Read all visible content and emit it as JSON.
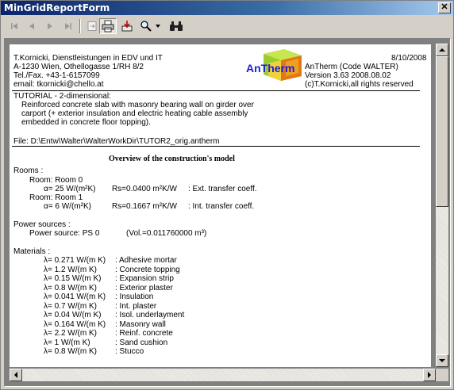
{
  "window": {
    "title": "MinGridReportForm",
    "close_glyph": "✕"
  },
  "toolbar": {
    "buttons": [
      {
        "name": "first-page-button",
        "icon": "first-page-icon"
      },
      {
        "name": "prev-page-button",
        "icon": "prev-page-icon"
      },
      {
        "name": "next-page-button",
        "icon": "next-page-icon"
      },
      {
        "name": "last-page-button",
        "icon": "last-page-icon"
      },
      {
        "name": "goto-page-button",
        "icon": "goto-page-icon"
      },
      {
        "name": "print-button",
        "icon": "printer-icon"
      },
      {
        "name": "export-button",
        "icon": "export-icon"
      },
      {
        "name": "zoom-button",
        "icon": "magnifier-icon"
      },
      {
        "name": "zoom-dropdown-button",
        "icon": "dropdown-arrow-icon"
      },
      {
        "name": "find-button",
        "icon": "binoculars-icon"
      }
    ]
  },
  "report": {
    "header": {
      "company_lines": [
        "T.Kornicki, Dienstleistungen in EDV und IT",
        "A-1230 Wien, Othellogasse 1/RH 8/2",
        "Tel./Fax. +43-1-6157099",
        "email: tkornicki@chello.at"
      ],
      "date": "8/10/2008",
      "logo_text": "AnTherm",
      "program_lines": [
        "AnTherm (Code WALTER)",
        "Version 3.63 2008.08.02",
        "(c)T.Kornicki,all rights reserved"
      ]
    },
    "tutorial": {
      "title": "TUTORIAL - 2-dimensional:",
      "lines": [
        "Reinforced concrete slab with masonry bearing wall on girder over",
        "carport (+ exterior insulation and electric heating cable assembly",
        "embedded in concrete floor topping)."
      ]
    },
    "file_line": "File: D:\\Entw\\Walter\\WalterWorkDir\\TUTOR2_orig.antherm",
    "overview_title": "Overview of the construction's model",
    "rooms": {
      "heading": "Rooms :",
      "items": [
        {
          "name": "Room: Room 0",
          "alpha": "α= 25 W/(m²K)",
          "rs": "Rs=0.0400 m²K/W",
          "desc": ": Ext. transfer coeff."
        },
        {
          "name": "Room: Room 1",
          "alpha": "α= 6 W/(m²K)",
          "rs": "Rs=0.1667 m²K/W",
          "desc": ": Int. transfer coeff."
        }
      ]
    },
    "power": {
      "heading": "Power sources :",
      "source": "Power source: PS 0",
      "vol": "(Vol.=0.011760000 m³)"
    },
    "materials": {
      "heading": "Materials :",
      "items": [
        {
          "lambda": "λ= 0.271 W/(m K)",
          "name": ": Adhesive mortar"
        },
        {
          "lambda": "λ= 1.2 W/(m K)",
          "name": ": Concrete topping"
        },
        {
          "lambda": "λ= 0.15 W/(m K)",
          "name": ": Expansion strip"
        },
        {
          "lambda": "λ= 0.8 W/(m K)",
          "name": ": Exterior plaster"
        },
        {
          "lambda": "λ= 0.041 W/(m K)",
          "name": ": Insulation"
        },
        {
          "lambda": "λ= 0.7 W/(m K)",
          "name": ": Int. plaster"
        },
        {
          "lambda": "λ= 0.04 W/(m K)",
          "name": ": Isol. underlayment"
        },
        {
          "lambda": "λ= 0.164 W/(m K)",
          "name": ": Masonry wall"
        },
        {
          "lambda": "λ= 2.2 W/(m K)",
          "name": ": Reinf. concrete"
        },
        {
          "lambda": "λ= 1 W/(m K)",
          "name": ": Sand cushion"
        },
        {
          "lambda": "λ= 0.8 W/(m K)",
          "name": ": Stucco"
        }
      ]
    }
  }
}
